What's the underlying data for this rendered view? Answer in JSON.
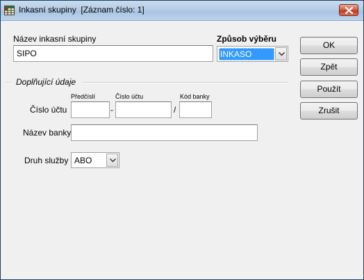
{
  "window": {
    "title": "Inkasní skupiny  [Záznam číslo: 1]",
    "icon": "table-grid-icon",
    "close_icon": "close-icon"
  },
  "form": {
    "group_name_label": "Název inkasní skupiny",
    "group_name_value": "SIPO",
    "selection_method_label": "Způsob výběru",
    "selection_method_value": "INKASO",
    "section_title": "Doplňující údaje",
    "account_number_label": "Číslo účtu",
    "prefix_label": "Předčíslí",
    "account_label": "Číslo účtu",
    "bank_code_label": "Kód banky",
    "dash": "-",
    "slash": "/",
    "prefix_value": "",
    "account_value": "",
    "bank_code_value": "",
    "bank_name_label": "Název banky",
    "bank_name_value": "",
    "service_type_label": "Druh služby",
    "service_type_value": "ABO"
  },
  "buttons": {
    "ok": "OK",
    "back": "Zpět",
    "apply": "Použít",
    "cancel": "Zrušit"
  },
  "colors": {
    "selection": "#3399ff",
    "window_bg": "#f0f0f0",
    "close_button": "#c2361c"
  }
}
